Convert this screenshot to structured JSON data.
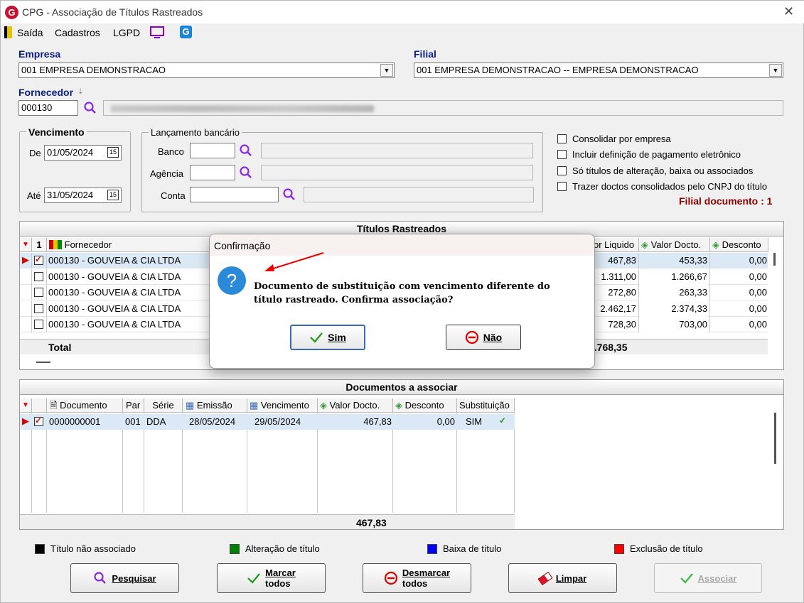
{
  "window": {
    "title": "CPG - Associação de Títulos Rastreados"
  },
  "menu": {
    "exit": "Saída",
    "registers": "Cadastros",
    "lgpd": "LGPD"
  },
  "company": {
    "label": "Empresa",
    "value": "001 EMPRESA DEMONSTRACAO"
  },
  "branch": {
    "label": "Filial",
    "value": "001 EMPRESA DEMONSTRACAO -- EMPRESA DEMONSTRACAO"
  },
  "supplier": {
    "label": "Fornecedor",
    "code": "000130"
  },
  "due": {
    "label": "Vencimento",
    "from_label": "De",
    "from": "01/05/2024",
    "to_label": "Até",
    "to": "31/05/2024"
  },
  "bank_entry": {
    "label": "Lançamento bancário",
    "bank": "Banco",
    "agency": "Agência",
    "account": "Conta"
  },
  "options": [
    {
      "label": "Consolidar por empresa",
      "checked": false
    },
    {
      "label": "Incluir definição de pagamento eletrônico",
      "checked": false
    },
    {
      "label": "Só títulos de alteração, baixa ou associados",
      "checked": false
    },
    {
      "label": "Trazer doctos consolidados pelo CNPJ do título",
      "checked": false
    }
  ],
  "filial_doc": "Filial documento : 1",
  "tracked": {
    "title": "Títulos Rastreados",
    "sort_col": "1",
    "col_supplier": "Fornecedor",
    "col_net": "or Liquido",
    "col_doc_value": "Valor Docto.",
    "col_discount": "Desconto",
    "rows": [
      {
        "supplier": "000130 - GOUVEIA & CIA LTDA",
        "net": "467,83",
        "doc_value": "453,33",
        "discount": "0,00",
        "checked": true
      },
      {
        "supplier": "000130 - GOUVEIA & CIA LTDA",
        "net": "1.311,00",
        "doc_value": "1.266,67",
        "discount": "0,00",
        "checked": false
      },
      {
        "supplier": "000130 - GOUVEIA & CIA LTDA",
        "net": "272,80",
        "doc_value": "263,33",
        "discount": "0,00",
        "checked": false
      },
      {
        "supplier": "000130 - GOUVEIA & CIA LTDA",
        "net": "2.462,17",
        "doc_value": "2.374,33",
        "discount": "0,00",
        "checked": false
      },
      {
        "supplier": "000130 - GOUVEIA & CIA LTDA",
        "net": "728,30",
        "doc_value": "703,00",
        "discount": "0,00",
        "checked": false
      }
    ],
    "total_label": "Total",
    "total_net": "5.768,35"
  },
  "docs": {
    "title": "Documentos a associar",
    "cols": {
      "document": "Documento",
      "par": "Par",
      "series": "Série",
      "issue": "Emissão",
      "due": "Vencimento",
      "value": "Valor Docto.",
      "discount": "Desconto",
      "subst": "Substituição"
    },
    "rows": [
      {
        "document": "0000000001",
        "par": "001",
        "series": "DDA",
        "issue": "28/05/2024",
        "due": "29/05/2024",
        "value": "467,83",
        "discount": "0,00",
        "subst": "SIM"
      }
    ],
    "total": "467,83"
  },
  "legend": {
    "not_assoc": "Título não associado",
    "changed": "Alteração de título",
    "paid": "Baixa de título",
    "deleted": "Exclusão de título"
  },
  "colors": {
    "not_assoc": "#000000",
    "changed": "#008000",
    "paid": "#0000ff",
    "deleted": "#ff0000",
    "label_blue": "#0a1e8a",
    "filial_doc": "#8b0000"
  },
  "buttons": {
    "search": "Pesquisar",
    "mark1": "Marcar",
    "mark2": "todos",
    "unmark1": "Desmarcar",
    "unmark2": "todos",
    "clear": "Limpar",
    "associate": "Associar"
  },
  "dialog": {
    "title": "Confirmação",
    "message": "Documento de substituição com vencimento diferente do título rastreado. Confirma associação?",
    "yes": "Sim",
    "no": "Não"
  }
}
